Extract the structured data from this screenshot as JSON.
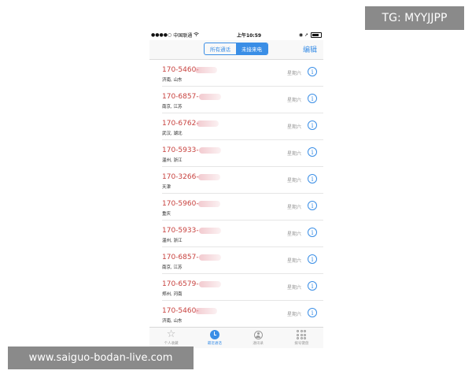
{
  "status_bar": {
    "signal": "●●●●○",
    "carrier": "中国联通",
    "wifi_icon": "wifi-icon",
    "time": "上午10:59",
    "right_icons": "◉ ➚",
    "battery_icon": "battery-icon"
  },
  "nav": {
    "segments": [
      "所有通话",
      "未接来电"
    ],
    "active_segment": "未接来电",
    "edit_label": "编辑"
  },
  "calls": [
    {
      "number": "170-5460-",
      "location": "济南, 山东",
      "day": "星期六"
    },
    {
      "number": "170-6857-",
      "location": "南京, 江苏",
      "day": "星期六"
    },
    {
      "number": "170-6762-",
      "location": "武汉, 湖北",
      "day": "星期六"
    },
    {
      "number": "170-5933-",
      "location": "温州, 浙江",
      "day": "星期六"
    },
    {
      "number": "170-3266-",
      "location": "天津",
      "day": "星期六"
    },
    {
      "number": "170-5960-",
      "location": "重庆",
      "day": "星期六"
    },
    {
      "number": "170-5933-",
      "location": "温州, 浙江",
      "day": "星期六"
    },
    {
      "number": "170-6857-",
      "location": "南京, 江苏",
      "day": "星期六"
    },
    {
      "number": "170-6579-",
      "location": "郑州, 河南",
      "day": "星期六"
    },
    {
      "number": "170-5460-",
      "location": "济南, 山东",
      "day": "星期六"
    }
  ],
  "info_glyph": "i",
  "tabs": [
    {
      "label": "个人收藏",
      "icon": "star-icon"
    },
    {
      "label": "最近通话",
      "icon": "clock-icon"
    },
    {
      "label": "通讯录",
      "icon": "contacts-icon"
    },
    {
      "label": "拨号键盘",
      "icon": "keypad-icon"
    }
  ],
  "tab_star_glyph": "☆",
  "watermarks": {
    "top_right": "TG: MYYJJPP",
    "bottom_left": "www.saiguo-bodan-live.com"
  },
  "colors": {
    "accent": "#3a8ee6",
    "missed_call": "#c8423f",
    "watermark_bg": "#8a8a8a"
  }
}
